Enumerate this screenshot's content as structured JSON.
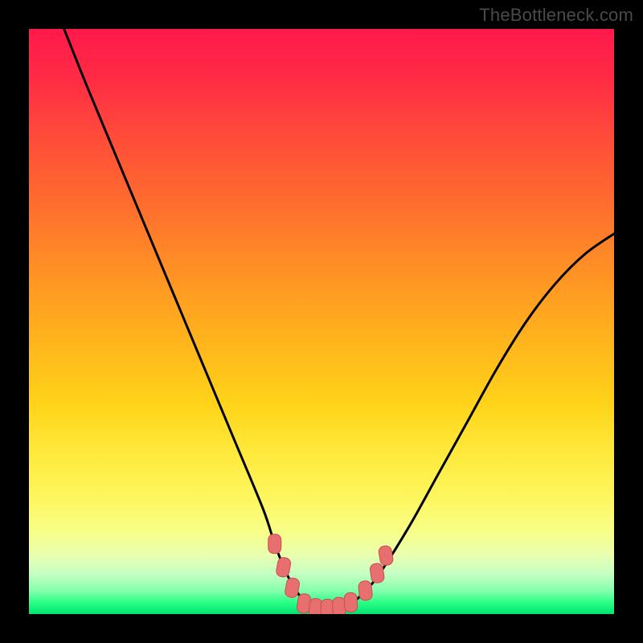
{
  "watermark": "TheBottleneck.com",
  "colors": {
    "frame": "#000000",
    "curve": "#000000",
    "marker_fill": "#e76f6f",
    "marker_stroke": "#c94f4f"
  },
  "chart_data": {
    "type": "line",
    "title": "",
    "xlabel": "",
    "ylabel": "",
    "xlim": [
      0,
      100
    ],
    "ylim": [
      0,
      100
    ],
    "grid": false,
    "legend": false,
    "series": [
      {
        "name": "curve",
        "x": [
          6,
          10,
          15,
          20,
          25,
          30,
          35,
          40,
          42,
          44,
          46,
          48,
          50,
          52,
          54,
          56,
          58,
          60,
          65,
          70,
          75,
          80,
          85,
          90,
          95,
          100
        ],
        "y": [
          100,
          90,
          78,
          66,
          54,
          42,
          30,
          18,
          12,
          7,
          3.5,
          1.5,
          0.8,
          0.8,
          1.2,
          2.5,
          4.5,
          7,
          15,
          24,
          33,
          42,
          50,
          56.5,
          61.5,
          65
        ]
      }
    ],
    "markers": [
      {
        "x": 42.0,
        "y": 12.0
      },
      {
        "x": 43.5,
        "y": 8.0
      },
      {
        "x": 45.0,
        "y": 4.5
      },
      {
        "x": 47.0,
        "y": 1.8
      },
      {
        "x": 49.0,
        "y": 1.0
      },
      {
        "x": 51.0,
        "y": 0.9
      },
      {
        "x": 53.0,
        "y": 1.2
      },
      {
        "x": 55.0,
        "y": 2.0
      },
      {
        "x": 57.5,
        "y": 4.0
      },
      {
        "x": 59.5,
        "y": 7.0
      },
      {
        "x": 61.0,
        "y": 10.0
      }
    ]
  }
}
